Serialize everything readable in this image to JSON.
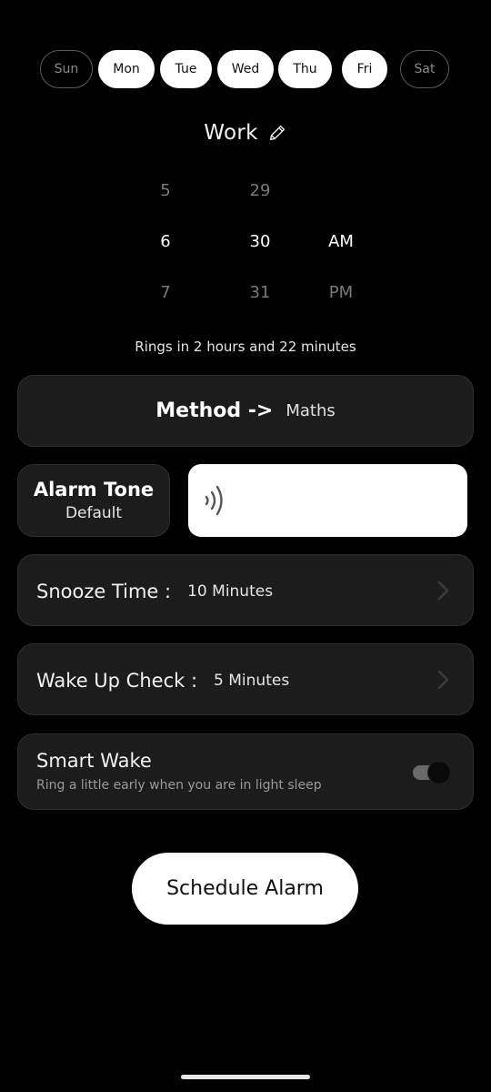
{
  "days": [
    {
      "label": "Sun",
      "selected": false
    },
    {
      "label": "Mon",
      "selected": true
    },
    {
      "label": "Tue",
      "selected": true
    },
    {
      "label": "Wed",
      "selected": true
    },
    {
      "label": "Thu",
      "selected": true
    },
    {
      "label": "Fri",
      "selected": true
    },
    {
      "label": "Sat",
      "selected": false
    }
  ],
  "alarm": {
    "label": "Work",
    "edit_icon": "pencil-icon"
  },
  "picker": {
    "hours": {
      "prev": "5",
      "current": "6",
      "next": "7"
    },
    "minutes": {
      "prev": "29",
      "current": "30",
      "next": "31"
    },
    "period": {
      "current": "AM",
      "next": "PM"
    }
  },
  "rings_in": "Rings in 2 hours and 22 minutes",
  "method": {
    "title": "Method ->",
    "value": "Maths"
  },
  "tone": {
    "title": "Alarm Tone",
    "value": "Default",
    "preview_icon": "sound-wave-icon"
  },
  "snooze": {
    "label": "Snooze Time :",
    "value": "10 Minutes",
    "icon": "chevron-right-icon"
  },
  "wake_check": {
    "label": "Wake Up Check :",
    "value": "5 Minutes",
    "icon": "chevron-right-icon"
  },
  "smart_wake": {
    "title": "Smart Wake",
    "subtitle": "Ring a little early when you are in light sleep",
    "enabled": true
  },
  "schedule_button": "Schedule Alarm",
  "colors": {
    "background": "#000000",
    "card": "#1c1c1c",
    "card_border": "#2f2f2f",
    "accent": "#ffffff"
  }
}
